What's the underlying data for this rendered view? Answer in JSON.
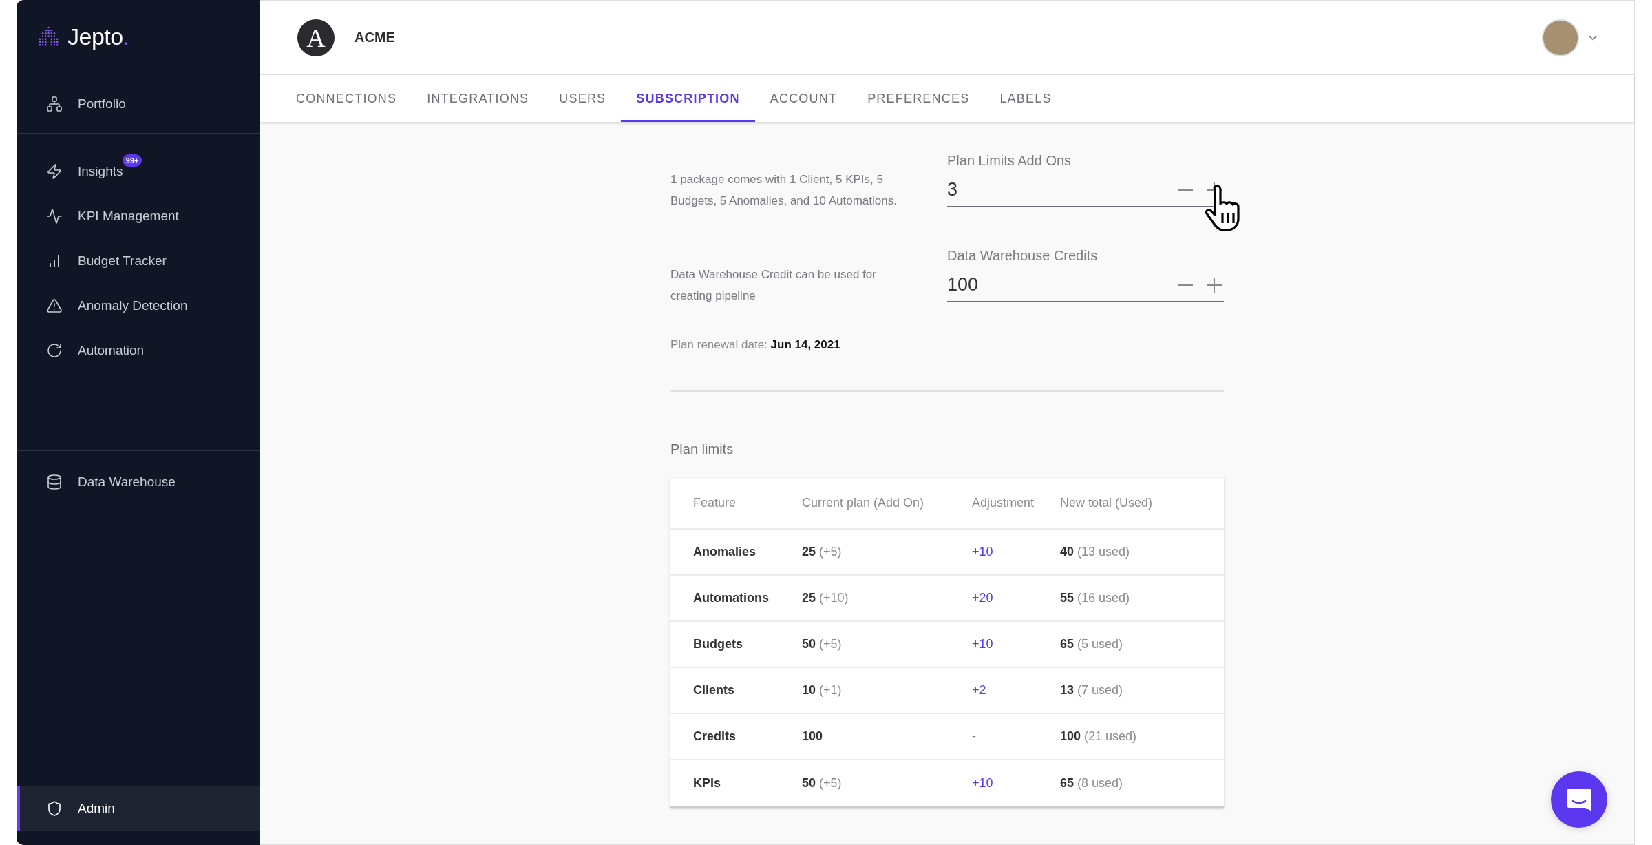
{
  "sidebar": {
    "logo": {
      "name": "Jepto",
      "mark": "."
    },
    "sections": [
      {
        "items": [
          {
            "label": "Portfolio",
            "selected": false
          }
        ]
      },
      {
        "items": [
          {
            "label": "Insights",
            "selected": false,
            "badge": "99+"
          },
          {
            "label": "KPI Management",
            "selected": false
          },
          {
            "label": "Budget Tracker",
            "selected": false
          },
          {
            "label": "Anomaly Detection",
            "selected": false
          },
          {
            "label": "Automation",
            "selected": false
          }
        ]
      },
      {
        "items": [
          {
            "label": "Data Warehouse",
            "selected": false
          }
        ]
      },
      {
        "items": [
          {
            "label": "Admin",
            "selected": true
          }
        ]
      }
    ]
  },
  "header": {
    "org": {
      "logo_letter": "A",
      "name": "ACME"
    }
  },
  "tabs": [
    {
      "label": "CONNECTIONS",
      "selected": false
    },
    {
      "label": "INTEGRATIONS",
      "selected": false
    },
    {
      "label": "USERS",
      "selected": false
    },
    {
      "label": "SUBSCRIPTION",
      "selected": true
    },
    {
      "label": "ACCOUNT",
      "selected": false
    },
    {
      "label": "PREFERENCES",
      "selected": false
    },
    {
      "label": "LABELS",
      "selected": false
    }
  ],
  "form": {
    "fields": [
      {
        "description": "1 package comes with 1 Client, 5 KPIs, 5 Budgets, 5 Anomalies, and 10 Automations.",
        "label": "Plan Limits Add Ons",
        "value": "3"
      },
      {
        "description": "Data Warehouse Credit can be used for creating pipeline",
        "label": "Data Warehouse Credits",
        "value": "100"
      }
    ],
    "renewal": "Plan renewal date: **Jun 14, 2021**"
  },
  "table": {
    "title": "Plan limits",
    "columns": [
      "Feature",
      "Current plan (Add On)",
      "Adjustment",
      "New total (Used)"
    ],
    "rows": [
      {
        "feature": "Anomalies",
        "current": "**25** (+5)",
        "adjustment": {
          "text": "+10",
          "color": "#5b37f0"
        },
        "new_total": "**40** (13 used)"
      },
      {
        "feature": "Automations",
        "current": "**25** (+10)",
        "adjustment": {
          "text": "+20",
          "color": "#5b37f0"
        },
        "new_total": "**55** (16 used)"
      },
      {
        "feature": "Budgets",
        "current": "**50** (+5)",
        "adjustment": {
          "text": "+10",
          "color": "#5b37f0"
        },
        "new_total": "**65** (5 used)"
      },
      {
        "feature": "Clients",
        "current": "**10** (+1)",
        "adjustment": {
          "text": "+2",
          "color": "#5b37f0"
        },
        "new_total": "**13** (7 used)"
      },
      {
        "feature": "Credits",
        "current": "**100**",
        "adjustment": {
          "text": "-",
          "color": "#777777"
        },
        "new_total": "**100** (21 used)"
      },
      {
        "feature": "KPIs",
        "current": "**50** (+5)",
        "adjustment": {
          "text": "+10",
          "color": "#5b37f0"
        },
        "new_total": "**65** (8 used)"
      }
    ]
  }
}
